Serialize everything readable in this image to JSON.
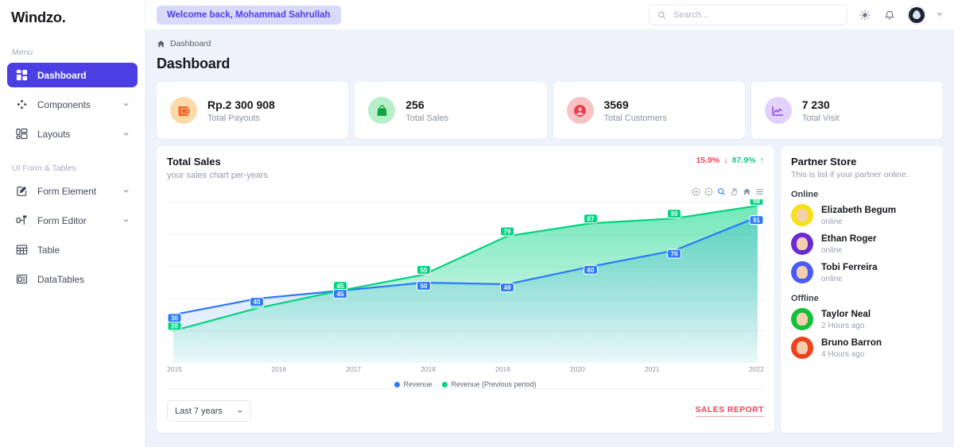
{
  "brand": {
    "name": "Windzo."
  },
  "sidebar": {
    "sections": [
      {
        "label": "Menu"
      },
      {
        "label": "UI Form & Tables"
      }
    ],
    "items": [
      {
        "label": "Dashboard",
        "icon": "grid-icon",
        "active": true,
        "expandable": false
      },
      {
        "label": "Components",
        "icon": "diamond-icon",
        "active": false,
        "expandable": true
      },
      {
        "label": "Layouts",
        "icon": "layout-icon",
        "active": false,
        "expandable": true
      },
      {
        "label": "Form Element",
        "icon": "edit-square-icon",
        "active": false,
        "expandable": true
      },
      {
        "label": "Form Editor",
        "icon": "editor-icon",
        "active": false,
        "expandable": true
      },
      {
        "label": "Table",
        "icon": "table-icon",
        "active": false,
        "expandable": false
      },
      {
        "label": "DataTables",
        "icon": "datatable-icon",
        "active": false,
        "expandable": false
      }
    ]
  },
  "topbar": {
    "welcome": "Welcome back, Mohammad Sahrullah",
    "search_placeholder": "Search...",
    "search_value": "",
    "icons": [
      "search-icon",
      "sun-icon",
      "bell-icon",
      "avatar",
      "chevron-down-icon"
    ]
  },
  "breadcrumb": {
    "home_icon": "home-icon",
    "label": "Dashboard"
  },
  "page": {
    "title": "Dashboard"
  },
  "stats": [
    {
      "value": "Rp.2 300 908",
      "label": "Total Payouts",
      "icon": "wallet-icon",
      "icon_bg": "#fcd9a8",
      "icon_color": "#f2662a"
    },
    {
      "value": "256",
      "label": "Total Sales",
      "icon": "shopping-bag-icon",
      "icon_bg": "#b7f0c8",
      "icon_color": "#12a33f"
    },
    {
      "value": "3569",
      "label": "Total Customers",
      "icon": "user-icon",
      "icon_bg": "#fbc2c4",
      "icon_color": "#ea3b4e"
    },
    {
      "value": "7 230",
      "label": "Total Visit",
      "icon": "line-chart-icon",
      "icon_bg": "#e2d1fb",
      "icon_color": "#8d47e0"
    }
  ],
  "chart_card": {
    "title": "Total Sales",
    "subtitle": "your sales chart per-years",
    "pct_down": "15.9%",
    "pct_up": "87.9%",
    "toolbar_icons": [
      "zoom-in-icon",
      "zoom-out-icon",
      "selection-zoom-icon",
      "pan-icon",
      "reset-home-icon",
      "menu-icon"
    ],
    "range_select": {
      "value": "Last 7 years",
      "options": [
        "Last 7 years"
      ]
    },
    "report_link": "SALES REPORT"
  },
  "chart_data": {
    "type": "line",
    "title": "Total Sales",
    "subtitle": "your sales chart per-years",
    "xlabel": "",
    "ylabel": "",
    "categories": [
      "2015",
      "2016",
      "2017",
      "2018",
      "2019",
      "2020",
      "2021",
      "2022"
    ],
    "series": [
      {
        "name": "Revenue",
        "color": "#2979ff",
        "values": [
          30,
          40,
          45,
          50,
          49,
          60,
          70,
          91
        ]
      },
      {
        "name": "Revenue (Previous period)",
        "color": "#00d37f",
        "values": [
          20,
          34,
          45,
          55,
          79,
          87,
          90,
          98
        ]
      }
    ],
    "ylim": [
      0,
      100
    ],
    "grid": true,
    "legend_position": "bottom",
    "data_labels": true,
    "fill": "gradient-area"
  },
  "partner": {
    "title": "Partner Store",
    "subtitle": "This is list if your partner online.",
    "groups": [
      {
        "label": "Online",
        "people": [
          {
            "name": "Elizabeth Begum",
            "status": "online",
            "avatar_bg": "#f7e017",
            "hair": "#b58a2e"
          },
          {
            "name": "Ethan Roger",
            "status": "online",
            "avatar_bg": "#6a2bd3",
            "hair": "#4a1b9c"
          },
          {
            "name": "Tobi Ferreira",
            "status": "online",
            "avatar_bg": "#4a5cf5",
            "hair": "#191b2e"
          }
        ]
      },
      {
        "label": "Offline",
        "people": [
          {
            "name": "Taylor Neal",
            "status": "2 Hours ago",
            "avatar_bg": "#14c038",
            "hair": "#2a2220"
          },
          {
            "name": "Bruno Barron",
            "status": "4 Hours ago",
            "avatar_bg": "#f0421c",
            "hair": "#e8571e"
          }
        ]
      }
    ]
  }
}
